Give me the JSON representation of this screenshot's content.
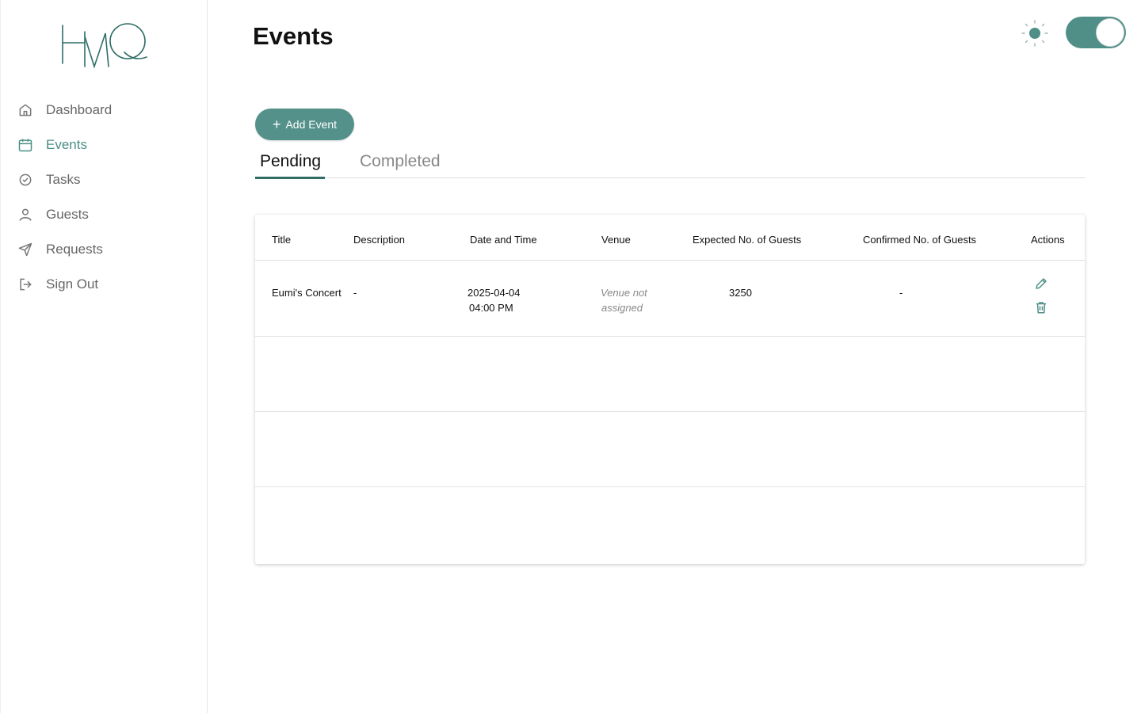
{
  "brand": {
    "logo_text": "HMQ",
    "accent_color": "#4f8f87"
  },
  "sidebar": {
    "items": [
      {
        "label": "Dashboard",
        "icon": "home-icon",
        "active": false
      },
      {
        "label": "Events",
        "icon": "calendar-icon",
        "active": true
      },
      {
        "label": "Tasks",
        "icon": "check-circle-icon",
        "active": false
      },
      {
        "label": "Guests",
        "icon": "user-icon",
        "active": false
      },
      {
        "label": "Requests",
        "icon": "send-icon",
        "active": false
      },
      {
        "label": "Sign Out",
        "icon": "sign-out-icon",
        "active": false
      }
    ]
  },
  "header": {
    "title": "Events",
    "theme_toggle_on": true
  },
  "toolbar": {
    "add_label": "Add Event"
  },
  "tabs": [
    {
      "label": "Pending",
      "active": true
    },
    {
      "label": "Completed",
      "active": false
    }
  ],
  "table": {
    "columns": [
      "Title",
      "Description",
      "Date and Time",
      "Venue",
      "Expected No. of Guests",
      "Confirmed No. of Guests",
      "Actions"
    ],
    "rows": [
      {
        "title": "Eumi's Concert",
        "description": "-",
        "date": "2025-04-04",
        "time": "04:00 PM",
        "venue_line1": "Venue not",
        "venue_line2": "assigned",
        "expected_guests": "3250",
        "confirmed_guests": "-"
      }
    ]
  }
}
